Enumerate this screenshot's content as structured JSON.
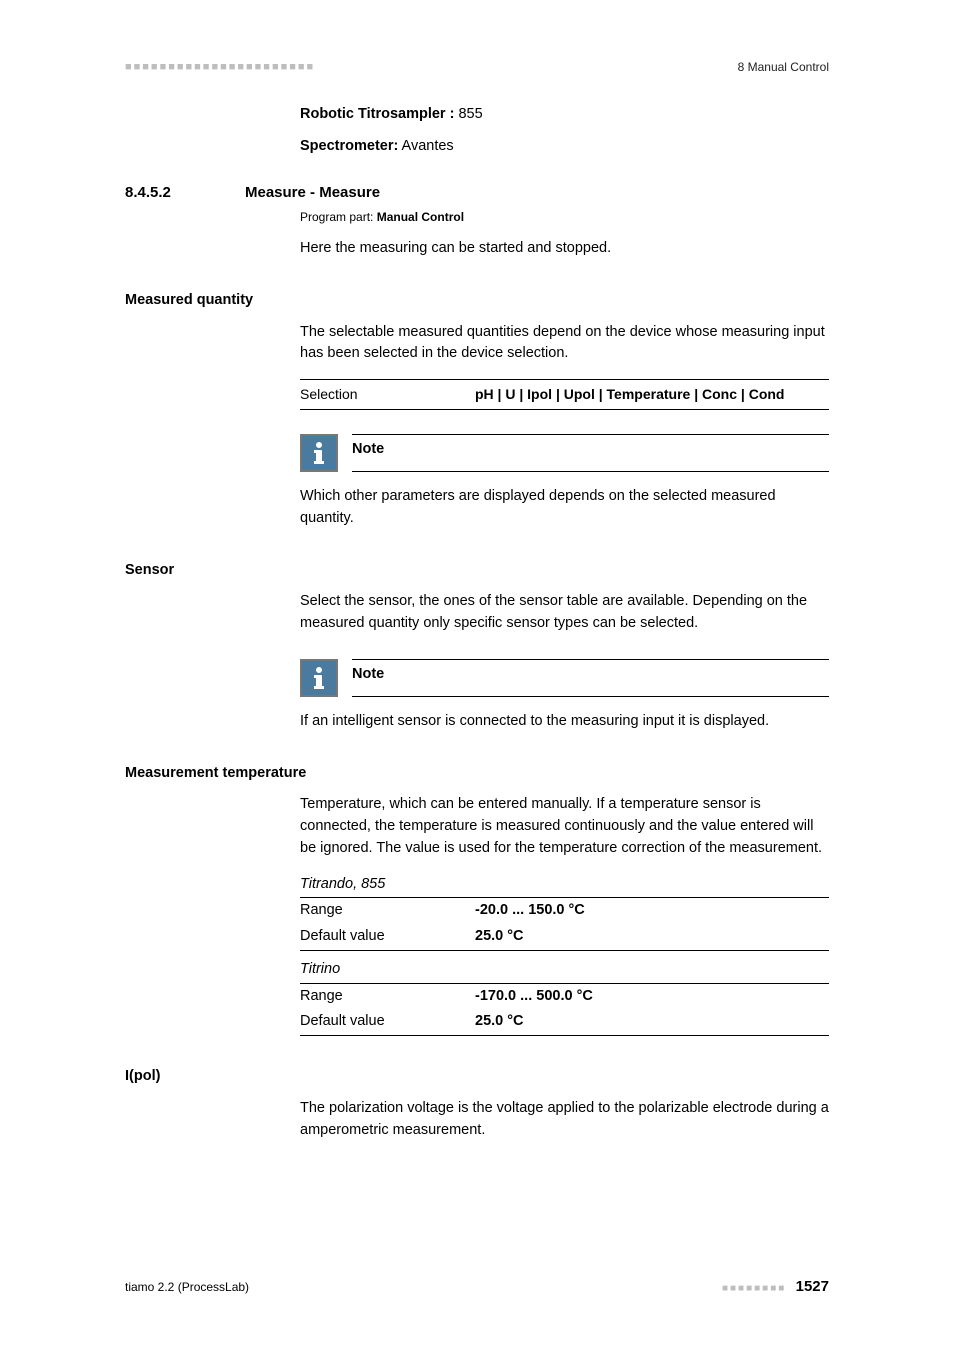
{
  "header": {
    "section": "8 Manual Control"
  },
  "list": {
    "robotic_label": "Robotic Titrosampler :",
    "robotic_value": " 855",
    "spectro_label": "Spectrometer:",
    "spectro_value": " Avantes"
  },
  "section": {
    "num": "8.4.5.2",
    "title": "Measure - Measure",
    "program_prefix": "Program part: ",
    "program_bold": "Manual Control",
    "intro": "Here the measuring can be started and stopped."
  },
  "measured_quantity": {
    "heading": "Measured quantity",
    "para": "The selectable measured quantities depend on the device whose measuring input has been selected in the device selection.",
    "selection_label": "Selection",
    "selection_value": "pH | U | Ipol | Upol | Temperature | Conc | Cond"
  },
  "note1": {
    "title": "Note",
    "body": "Which other parameters are displayed depends on the selected measured quantity."
  },
  "sensor": {
    "heading": "Sensor",
    "para": "Select the sensor, the ones of the sensor table are available. Depending on the measured quantity only specific sensor types can be selected."
  },
  "note2": {
    "title": "Note",
    "body": "If an intelligent sensor is connected to the measuring input it is displayed."
  },
  "measurement_temp": {
    "heading": "Measurement temperature",
    "para": "Temperature, which can be entered manually. If a temperature sensor is connected, the temperature is measured continuously and the value entered will be ignored. The value is used for the temperature correction of the measurement.",
    "group1_caption": "Titrando, 855",
    "group1_range_label": "Range",
    "group1_range_value": "-20.0 ... 150.0 °C",
    "group1_default_label": "Default value",
    "group1_default_value": "25.0 °C",
    "group2_caption": "Titrino",
    "group2_range_label": "Range",
    "group2_range_value": "-170.0 ... 500.0 °C",
    "group2_default_label": "Default value",
    "group2_default_value": "25.0 °C"
  },
  "ipol": {
    "heading": "I(pol)",
    "para": "The polarization voltage is the voltage applied to the polarizable electrode during a amperometric measurement."
  },
  "footer": {
    "left": "tiamo 2.2 (ProcessLab)",
    "page": "1527"
  }
}
